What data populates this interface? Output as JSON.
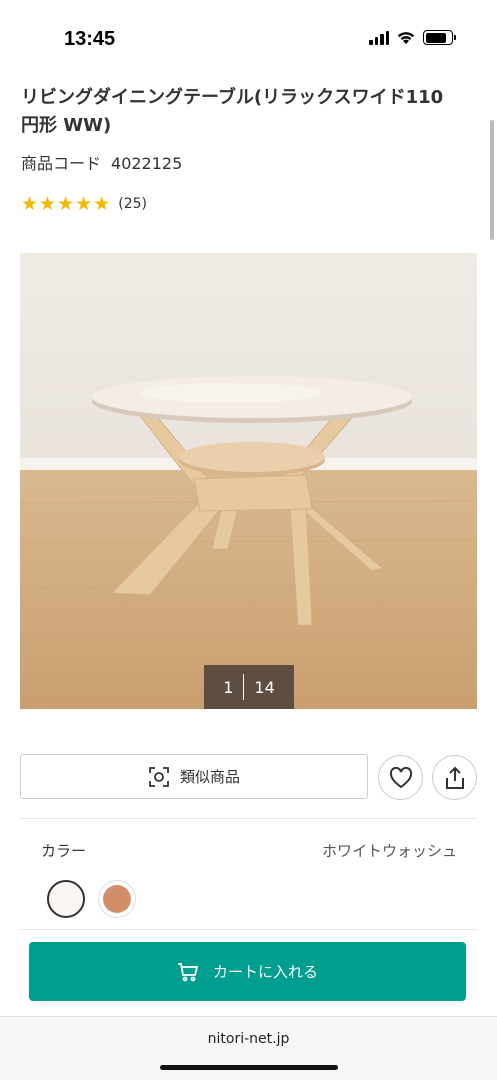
{
  "status_bar": {
    "time": "13:45"
  },
  "product": {
    "title": "リビングダイニングテーブル(リラックスワイド110円形 WW)",
    "code_label": "商品コード",
    "code_value": "4022125",
    "rating": {
      "stars": 5,
      "review_count": "(25)"
    }
  },
  "gallery": {
    "current": "1",
    "total": "14"
  },
  "actions": {
    "similar_label": "類似商品",
    "favorite_icon": "heart-icon",
    "share_icon": "share-icon"
  },
  "color_selector": {
    "label": "カラー",
    "selected_value": "ホワイトウォッシュ",
    "swatches": [
      {
        "name": "white-wash",
        "color": "#faf6f3",
        "selected": true
      },
      {
        "name": "brown",
        "color": "#d28e69",
        "selected": false
      }
    ]
  },
  "cart": {
    "label": "カートに入れる"
  },
  "browser": {
    "url": "nitori-net.jp"
  },
  "colors": {
    "accent": "#009e8f",
    "star": "#f5b800"
  }
}
